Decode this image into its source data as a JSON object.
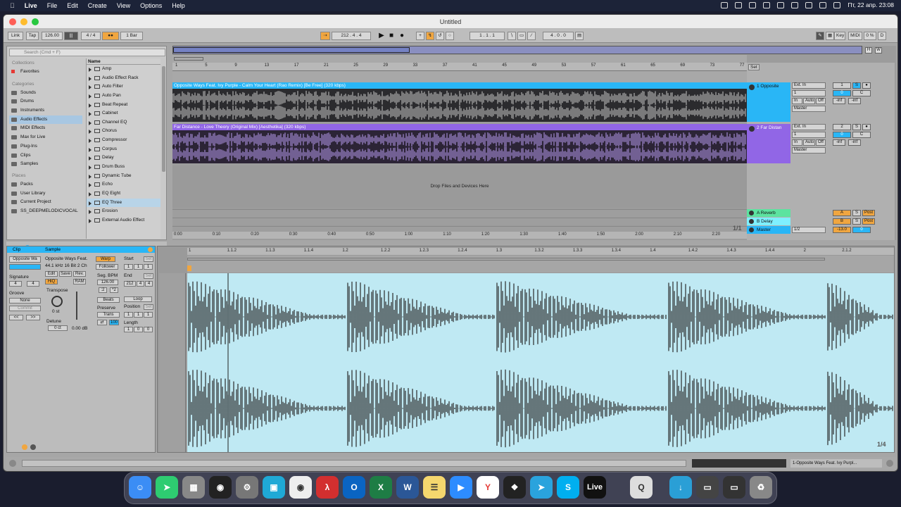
{
  "menubar": {
    "items": [
      "Live",
      "File",
      "Edit",
      "Create",
      "View",
      "Options",
      "Help"
    ],
    "datetime": "Пт, 22 апр.  23:08"
  },
  "window": {
    "title": "Untitled"
  },
  "transport": {
    "link": "Link",
    "tap": "Tap",
    "tempo": "126.00",
    "signature": "4 / 4",
    "quant": "1 Bar",
    "position": "212 .  4 .  4",
    "loop_start": "1 .  1 .  1",
    "loop_len": "4 .  0 .  0",
    "key": "Key",
    "midi": "MIDI",
    "cpu": "0 %",
    "d": "D"
  },
  "browser": {
    "search_placeholder": "Search (Cmd + F)",
    "collections_header": "Collections",
    "favorites": "Favorites",
    "categories_header": "Categories",
    "categories": [
      "Sounds",
      "Drums",
      "Instruments",
      "Audio Effects",
      "MIDI Effects",
      "Max for Live",
      "Plug-Ins",
      "Clips",
      "Samples"
    ],
    "selected_category": "Audio Effects",
    "places_header": "Places",
    "places": [
      "Packs",
      "User Library",
      "Current Project",
      "SS_DEEPMELODICVOCAL"
    ],
    "name_header": "Name",
    "items": [
      "Amp",
      "Audio Effect Rack",
      "Auto Filter",
      "Auto Pan",
      "Beat Repeat",
      "Cabinet",
      "Channel EQ",
      "Chorus",
      "Compressor",
      "Corpus",
      "Delay",
      "Drum Buss",
      "Dynamic Tube",
      "Echo",
      "EQ Eight",
      "EQ Three",
      "Erosion",
      "External Audio Effect"
    ],
    "selected_item": "EQ Three"
  },
  "arrangement": {
    "bars": [
      "1",
      "5",
      "9",
      "13",
      "17",
      "21",
      "25",
      "29",
      "33",
      "37",
      "41",
      "45",
      "49",
      "53",
      "57",
      "61",
      "65",
      "69",
      "73",
      "77"
    ],
    "times": [
      "0:00",
      "0:10",
      "0:20",
      "0:30",
      "0:40",
      "0:50",
      "1:00",
      "1:10",
      "1:20",
      "1:30",
      "1:40",
      "1:50",
      "2:00",
      "2:10",
      "2:20"
    ],
    "drop_text": "Drop Files and Devices Here",
    "page": "1/1",
    "set": "Set",
    "tracks": [
      {
        "clip_name": "Opposite Ways Feat. Ivy Purple - Calm Your Heart (Rao Remix) [Be Free] (320 kbps)",
        "track_name": "1 Opposite",
        "input": "Ext. In",
        "channel": "1",
        "output": "Master",
        "number": "1",
        "send": "0",
        "vol": "-inf",
        "pan": "C",
        "color": "#29b6f6"
      },
      {
        "clip_name": "Far Distance - Love Theory (Original Mix) [Aesthetika] (320 kbps)",
        "track_name": "2 Far Distan",
        "input": "Ext. In",
        "channel": "1",
        "output": "Master",
        "number": "2",
        "send": "0",
        "vol": "-inf",
        "pan": "C",
        "color": "#9166e6"
      }
    ],
    "returns": [
      {
        "name": "A Reverb",
        "letter": "A"
      },
      {
        "name": "B Delay",
        "letter": "B"
      }
    ],
    "master": {
      "name": "Master",
      "ratio": "1/2",
      "vol": "-13.0",
      "pan": "0"
    },
    "io_labels": {
      "in": "In",
      "auto": "Auto",
      "off": "Off",
      "s": "S",
      "post": "Post"
    }
  },
  "clip_view": {
    "clip_tab": "Clip",
    "sample_tab": "Sample",
    "clip_name": "Opposite Wa",
    "sample_name": "Opposite Ways Feat.",
    "sample_info": "44.1 kHz 16 Bit 2 Ch",
    "signature_label": "Signature",
    "sig_num": "4",
    "sig_den": "4",
    "groove_label": "Groove",
    "groove_val": "None",
    "commit": "Commit",
    "edit": "Edit",
    "save": "Save",
    "rev": "Rev.",
    "hiq": "HiQ",
    "ram": "RAM",
    "warp": "Warp",
    "follower": "Follower",
    "seg_bpm_label": "Seg. BPM",
    "seg_bpm": "126.00",
    "half": ":2",
    "double": "*2",
    "beats": "Beats",
    "preserve_label": "Preserve",
    "trans": "Trans",
    "val100": "100",
    "transpose_label": "Transpose",
    "transpose_val": "0 st",
    "detune_label": "Detune",
    "detune_val": "0 ct",
    "gain_val": "0.00 dB",
    "start_label": "Start",
    "start_vals": [
      "1",
      "1",
      "1"
    ],
    "end_label": "End",
    "end_vals": [
      "212",
      "4",
      "4"
    ],
    "loop": "Loop",
    "position_label": "Position",
    "position_vals": [
      "1",
      "1",
      "1"
    ],
    "length_label": "Length",
    "length_vals": [
      "1",
      "0",
      "0"
    ],
    "set": "Set"
  },
  "editor": {
    "ruler": [
      "1",
      "1.1.2",
      "1.1.3",
      "1.1.4",
      "1.2",
      "1.2.2",
      "1.2.3",
      "1.2.4",
      "1.3",
      "1.3.2",
      "1.3.3",
      "1.3.4",
      "1.4",
      "1.4.2",
      "1.4.3",
      "1.4.4",
      "2",
      "2.1.2"
    ],
    "page": "1/4"
  },
  "status": {
    "text": "1-Opposite Ways Feat. Ivy Purpl..."
  },
  "dock": {
    "live": "Live"
  }
}
